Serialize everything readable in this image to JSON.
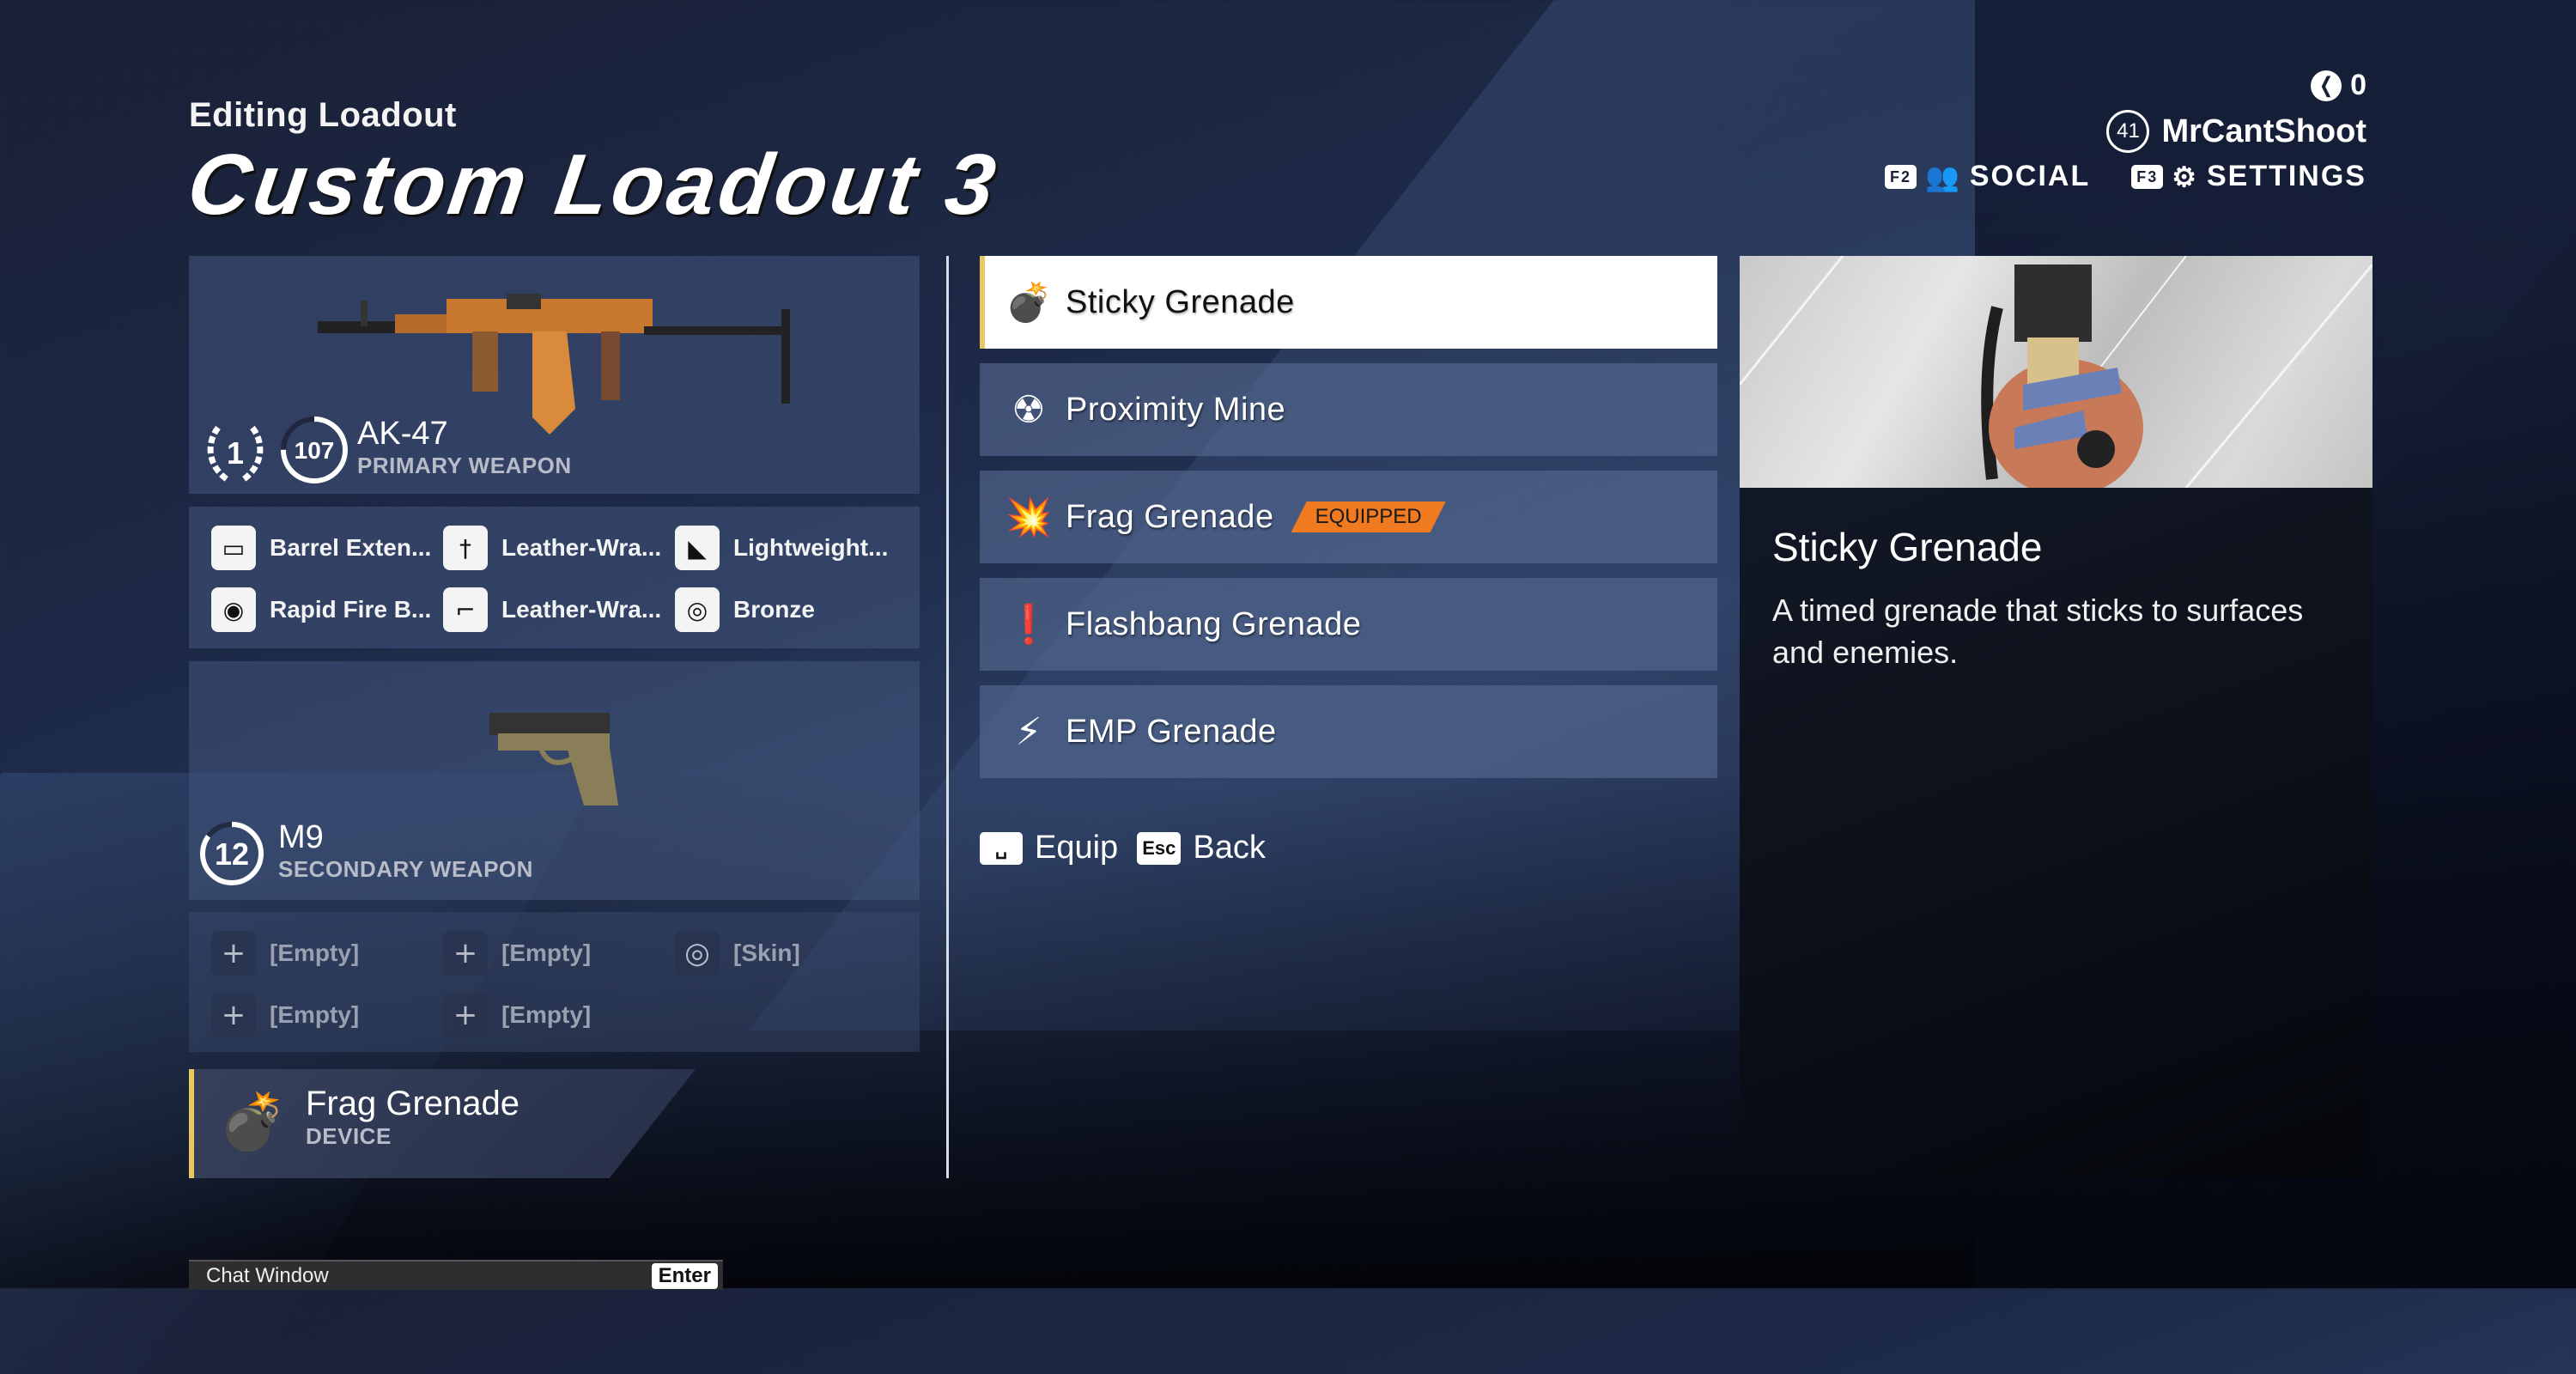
{
  "header": {
    "subtitle": "Editing Loadout",
    "title": "Custom Loadout 3"
  },
  "account": {
    "currency_icon": "coin-icon",
    "currency_amount": "0",
    "player_level": "41",
    "username": "MrCantShoot"
  },
  "nav": {
    "social": {
      "key": "F2",
      "icon": "friends-icon",
      "label": "SOCIAL"
    },
    "settings": {
      "key": "F3",
      "icon": "gear-icon",
      "label": "SETTINGS"
    }
  },
  "primary": {
    "mastery_rank": "1",
    "level": "107",
    "level_progress": 0.75,
    "name": "AK-47",
    "type": "PRIMARY WEAPON",
    "attachments": [
      {
        "icon": "barrel-icon",
        "label": "Barrel Exten..."
      },
      {
        "icon": "grip-icon",
        "label": "Leather-Wra..."
      },
      {
        "icon": "stock-icon",
        "label": "Lightweight..."
      },
      {
        "icon": "magazine-icon",
        "label": "Rapid Fire B..."
      },
      {
        "icon": "pistol-grip-icon",
        "label": "Leather-Wra..."
      },
      {
        "icon": "skin-eye-icon",
        "label": "Bronze"
      }
    ]
  },
  "secondary": {
    "level": "12",
    "level_progress": 0.85,
    "name": "M9",
    "type": "SECONDARY WEAPON",
    "attachments": [
      {
        "icon": "plus-icon",
        "label": "[Empty]"
      },
      {
        "icon": "plus-icon",
        "label": "[Empty]"
      },
      {
        "icon": "skin-eye-icon",
        "label": "[Skin]"
      },
      {
        "icon": "plus-icon",
        "label": "[Empty]"
      },
      {
        "icon": "plus-icon",
        "label": "[Empty]"
      }
    ]
  },
  "device": {
    "name": "Frag Grenade",
    "type": "DEVICE"
  },
  "device_list": {
    "selected_index": 0,
    "equipped_index": 2,
    "equipped_badge": "EQUIPPED",
    "items": [
      {
        "icon": "sticky-grenade-icon",
        "label": "Sticky Grenade"
      },
      {
        "icon": "proximity-mine-icon",
        "label": "Proximity Mine"
      },
      {
        "icon": "frag-grenade-icon",
        "label": "Frag Grenade"
      },
      {
        "icon": "flashbang-icon",
        "label": "Flashbang Grenade"
      },
      {
        "icon": "emp-grenade-icon",
        "label": "EMP Grenade"
      }
    ]
  },
  "hints": {
    "equip": {
      "key": "␣",
      "label": "Equip"
    },
    "back": {
      "key": "Esc",
      "label": "Back"
    }
  },
  "detail": {
    "title": "Sticky Grenade",
    "description": "A timed grenade that sticks to surfaces and enemies."
  },
  "chat": {
    "label": "Chat Window",
    "key": "Enter"
  },
  "colors": {
    "accent_yellow": "#e8c860",
    "equipped_orange": "#f07a20"
  }
}
